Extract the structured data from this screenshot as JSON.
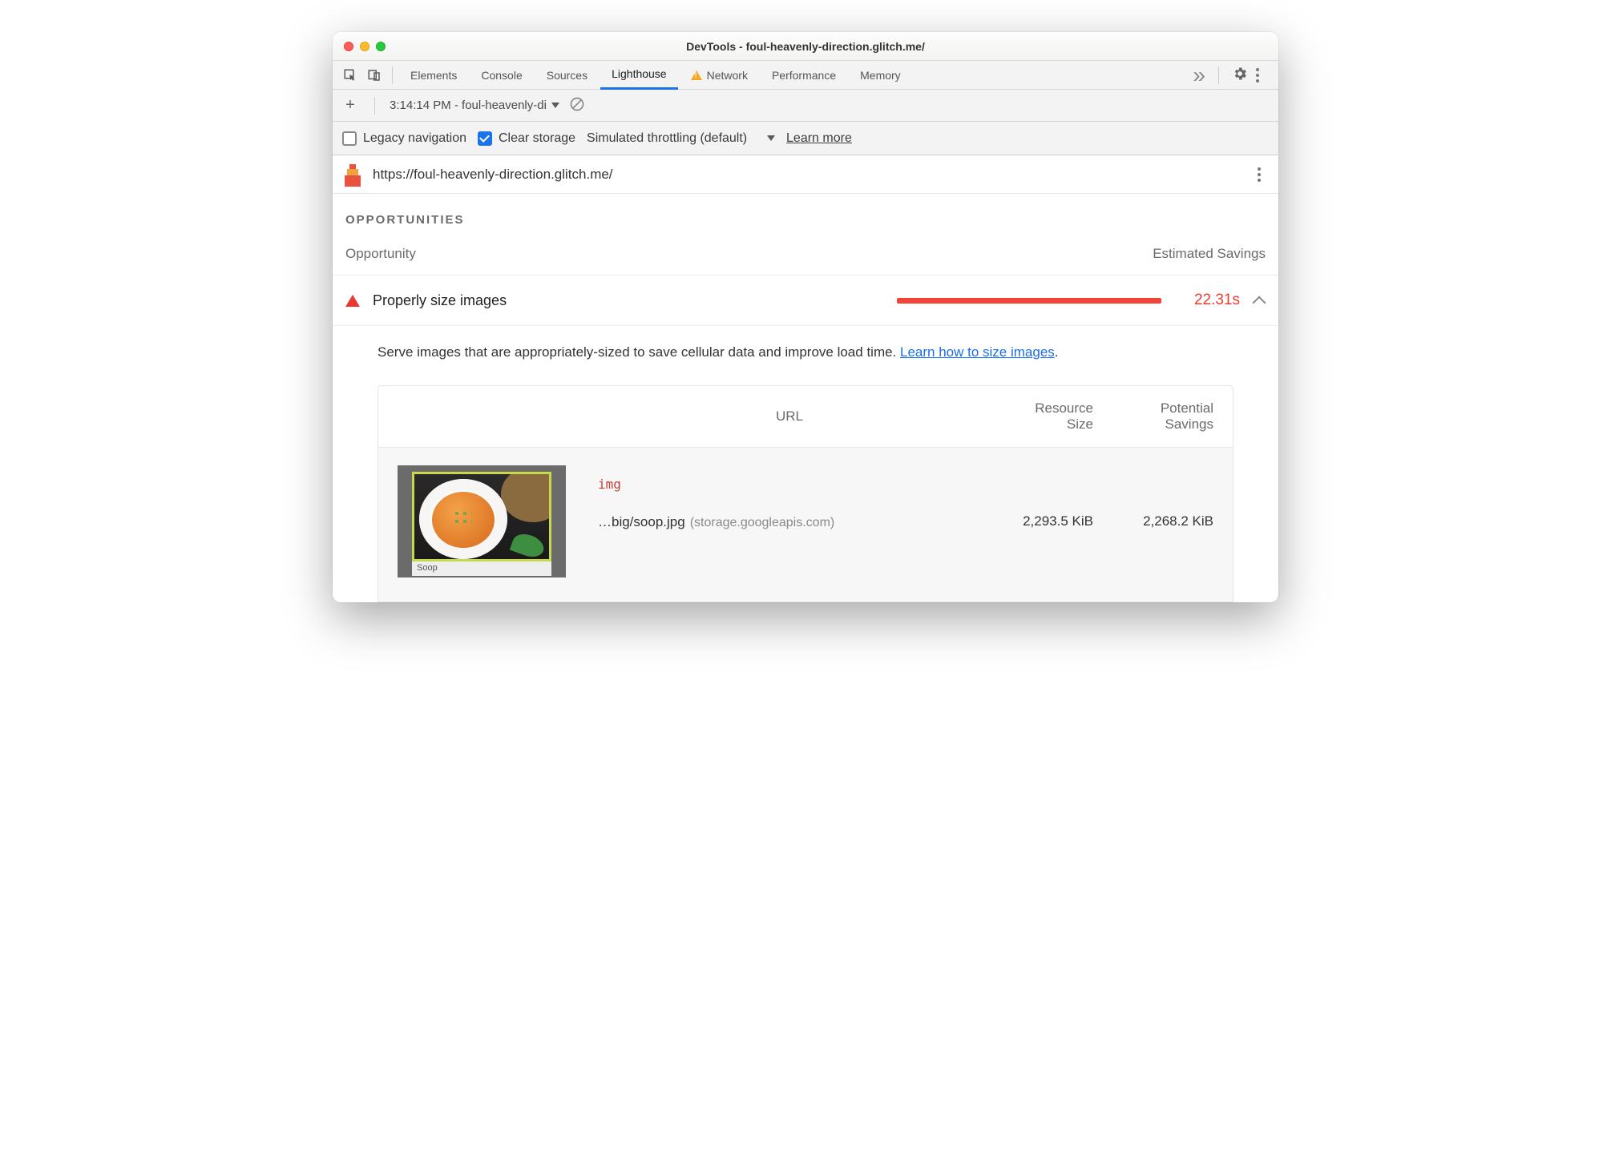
{
  "window": {
    "title": "DevTools - foul-heavenly-direction.glitch.me/"
  },
  "tabs": {
    "elements": "Elements",
    "console": "Console",
    "sources": "Sources",
    "lighthouse": "Lighthouse",
    "network": "Network",
    "performance": "Performance",
    "memory": "Memory"
  },
  "run": {
    "label": "3:14:14 PM - foul-heavenly-di"
  },
  "options": {
    "legacy_nav": "Legacy navigation",
    "clear_storage": "Clear storage",
    "throttle": "Simulated throttling (default)",
    "learn_more": "Learn more"
  },
  "url": "https://foul-heavenly-direction.glitch.me/",
  "section": "OPPORTUNITIES",
  "cols": {
    "opportunity": "Opportunity",
    "savings": "Estimated Savings"
  },
  "opp": {
    "title": "Properly size images",
    "savings": "22.31s",
    "desc_pre": "Serve images that are appropriately-sized to save cellular data and improve load time. ",
    "desc_link": "Learn how to size images",
    "table": {
      "h_url": "URL",
      "h_rs1": "Resource",
      "h_rs2": "Size",
      "h_ps1": "Potential",
      "h_ps2": "Savings",
      "row": {
        "tag": "img",
        "caption": "Soop",
        "path": "…big/soop.jpg",
        "host": "(storage.googleapis.com)",
        "resource_size": "2,293.5 KiB",
        "potential_savings": "2,268.2 KiB"
      }
    }
  }
}
